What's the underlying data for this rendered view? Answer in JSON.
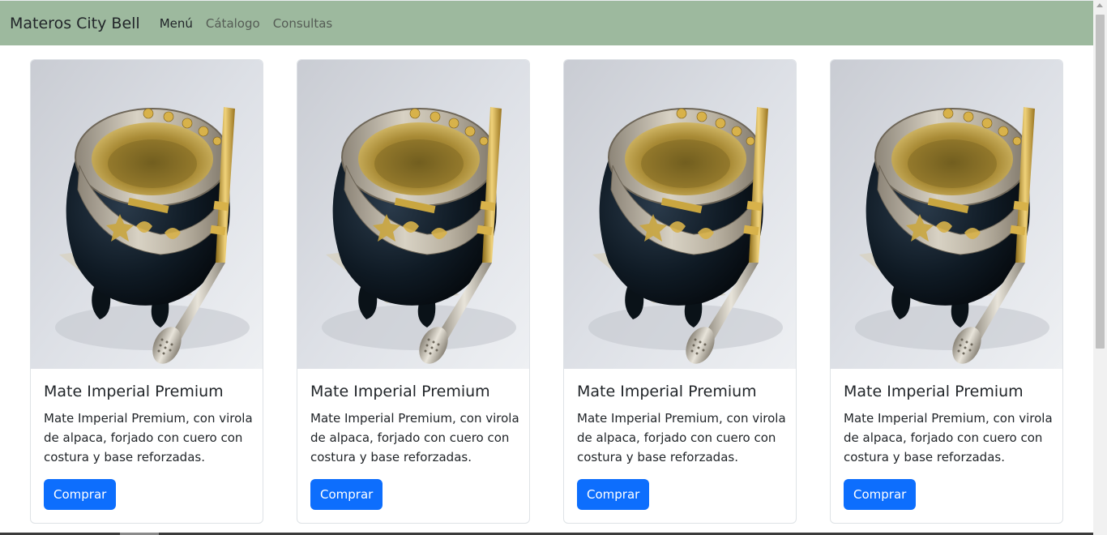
{
  "navbar": {
    "brand": "Materos City Bell",
    "links": [
      "Menú",
      "Cátalogo",
      "Consultas"
    ]
  },
  "colors": {
    "navbar_bg": "#9db99e",
    "button_bg": "#0d6efd",
    "mate_body": "#0f1a24",
    "silver": "#b8b0a0",
    "gold": "#d4a83a"
  },
  "products": [
    {
      "image_icon": "mate-gourd-image",
      "title": "Mate Imperial Premium",
      "description": "Mate Imperial Premium, con virola de alpaca, forjado con cuero con costura y base reforzadas.",
      "button": "Comprar"
    },
    {
      "image_icon": "mate-gourd-image",
      "title": "Mate Imperial Premium",
      "description": "Mate Imperial Premium, con virola de alpaca, forjado con cuero con costura y base reforzadas.",
      "button": "Comprar"
    },
    {
      "image_icon": "mate-gourd-image",
      "title": "Mate Imperial Premium",
      "description": "Mate Imperial Premium, con virola de alpaca, forjado con cuero con costura y base reforzadas.",
      "button": "Comprar"
    },
    {
      "image_icon": "mate-gourd-image",
      "title": "Mate Imperial Premium",
      "description": "Mate Imperial Premium, con virola de alpaca, forjado con cuero con costura y base reforzadas.",
      "button": "Comprar"
    }
  ]
}
